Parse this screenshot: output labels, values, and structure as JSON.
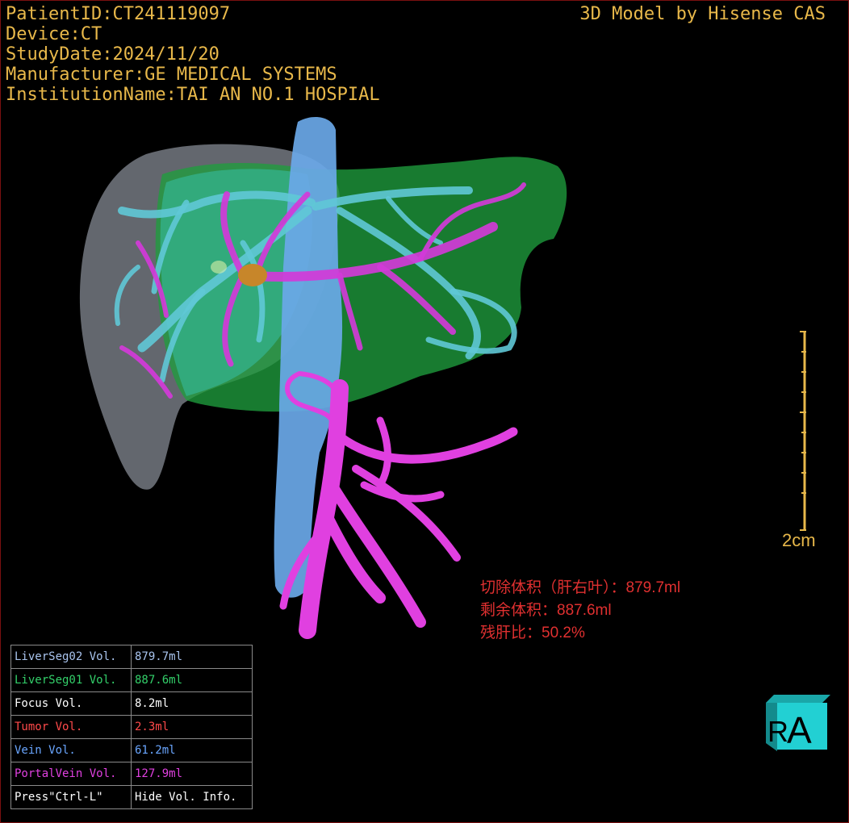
{
  "header": {
    "patient_id": "PatientID:CT241119097",
    "device": "Device:CT",
    "study_date": "StudyDate:2024/11/20",
    "manufacturer": "Manufacturer:GE MEDICAL SYSTEMS",
    "institution": "InstitutionName:TAI AN NO.1 HOSPIAL",
    "vendor": "3D Model by Hisense CAS"
  },
  "scale_bar": {
    "label": "2cm"
  },
  "resection": {
    "line1": "切除体积（肝右叶）：879.7ml",
    "line2": "剩余体积：887.6ml",
    "line3": "残肝比：50.2%"
  },
  "volumes": [
    {
      "name": "LiverSeg02 Vol.",
      "value": "879.7ml",
      "color": "#a9c4ee"
    },
    {
      "name": "LiverSeg01 Vol.",
      "value": "887.6ml",
      "color": "#33d06a"
    },
    {
      "name": "Focus Vol.",
      "value": "8.2ml",
      "color": "#ffffff"
    },
    {
      "name": "Tumor Vol.",
      "value": "2.3ml",
      "color": "#ff4a4a"
    },
    {
      "name": "Vein Vol.",
      "value": "61.2ml",
      "color": "#6aa6ff"
    },
    {
      "name": "PortalVein Vol.",
      "value": "127.9ml",
      "color": "#e040e0"
    }
  ],
  "hint": {
    "key": "Press\"Ctrl-L\"",
    "action": "Hide Vol. Info."
  },
  "orientation_cube": {
    "front": "A",
    "side": "R"
  },
  "colors": {
    "header_text": "#e8b84a",
    "liver_right_lobe": "#8a8f98",
    "liver_left_lobe": "#1f9e3e",
    "hepatic_vein": "#5fc8d6",
    "portal_vein": "#d23ad8",
    "ivc": "#6aa8e8",
    "tumor": "#c7862a",
    "resection_text": "#e03030"
  }
}
